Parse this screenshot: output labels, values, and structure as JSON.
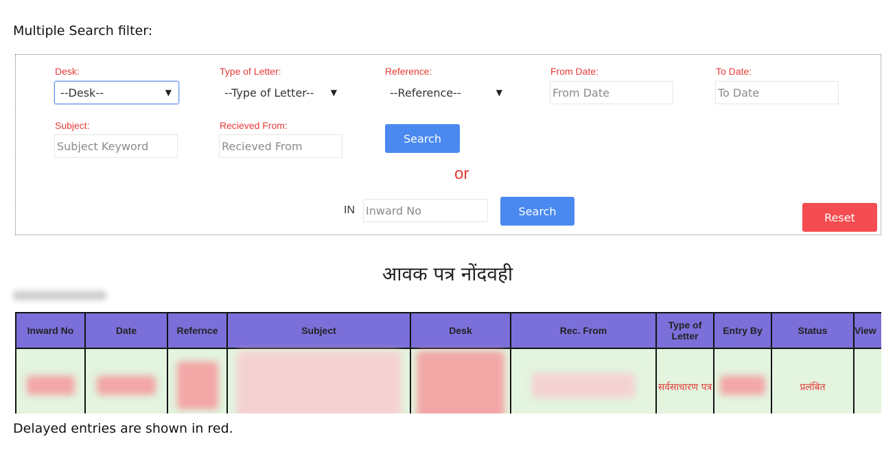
{
  "heading": "Multiple Search filter:",
  "filters": {
    "desk": {
      "label": "Desk:",
      "value": "--Desk--"
    },
    "type_of_letter": {
      "label": "Type of Letter:",
      "value": "--Type of Letter--"
    },
    "reference": {
      "label": "Reference:",
      "value": "--Reference--"
    },
    "from_date": {
      "label": "From Date:",
      "placeholder": "From Date"
    },
    "to_date": {
      "label": "To Date:",
      "placeholder": "To Date"
    },
    "subject": {
      "label": "Subject:",
      "placeholder": "Subject Keyword"
    },
    "received_from": {
      "label": "Recieved From:",
      "placeholder": "Recieved From"
    },
    "search_label": "Search",
    "or_label": "or",
    "inward_prefix": "IN",
    "inward_placeholder": "Inward No",
    "inward_search_label": "Search",
    "reset_label": "Reset"
  },
  "page_title": "आवक पत्र नोंदवही",
  "table": {
    "headers": [
      "Inward No",
      "Date",
      "Refernce",
      "Subject",
      "Desk",
      "Rec. From",
      "Type of Letter",
      "Entry By",
      "Status",
      "View"
    ],
    "row": {
      "type_of_letter": "सर्वसाधारण पत्र",
      "status": "प्रलंबित"
    }
  },
  "footer_note": "Delayed entries are shown in red.",
  "colors": {
    "header_bg": "#7b6fd9",
    "row_bg": "#e3f4df",
    "label_red": "#e53935",
    "search_blue": "#4a89f0",
    "reset_red": "#f44c50"
  }
}
